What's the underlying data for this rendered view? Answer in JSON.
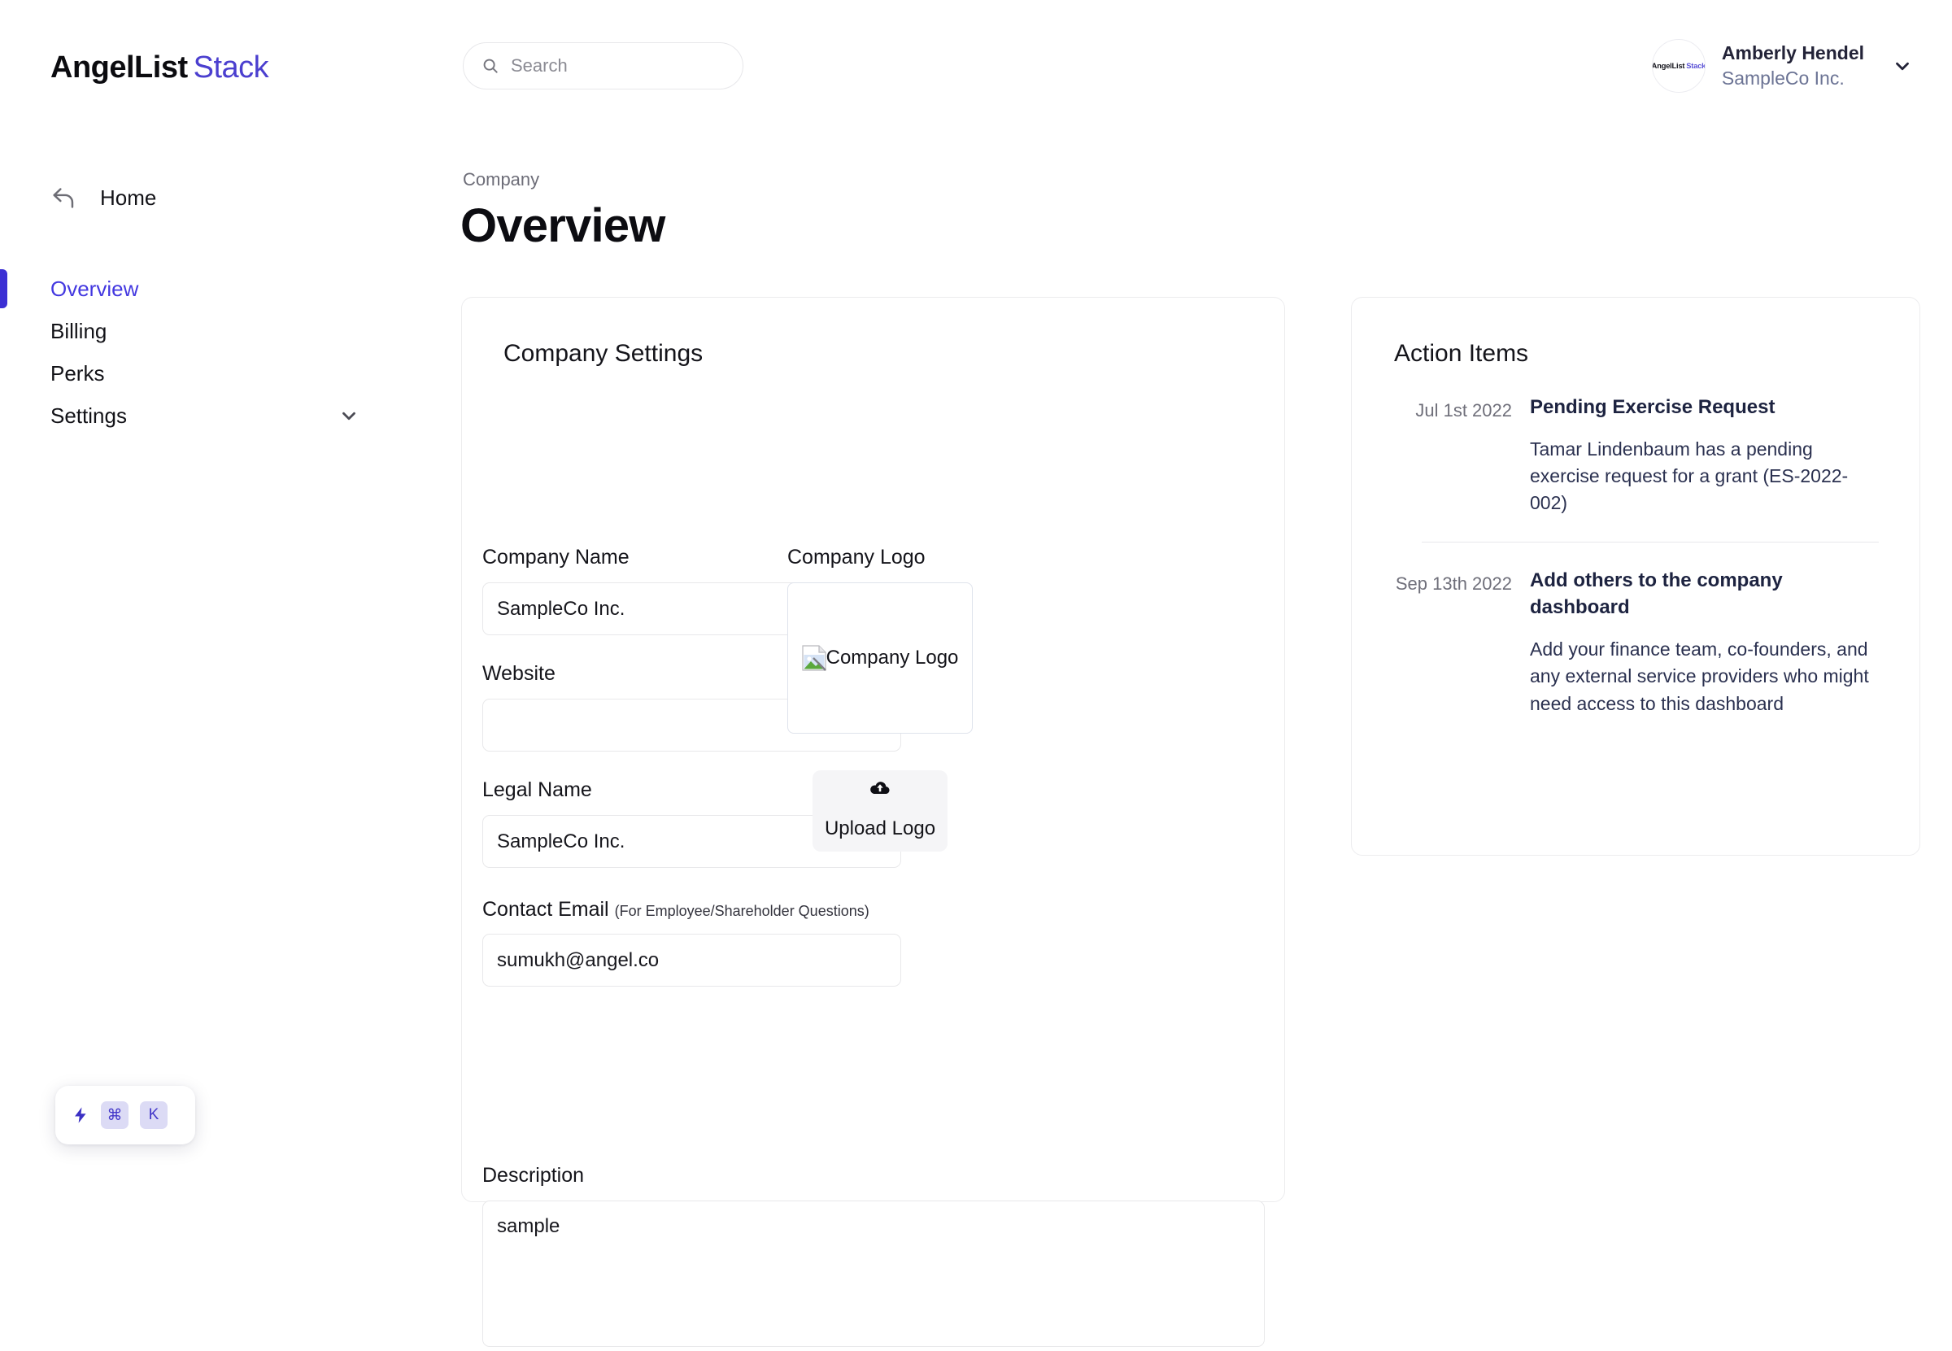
{
  "brand": {
    "primary": "AngelList",
    "secondary": "Stack",
    "accent_color": "#4b3fcf"
  },
  "search": {
    "placeholder": "Search",
    "value": "",
    "icon": "search-icon"
  },
  "user": {
    "name": "Amberly Hendel",
    "company": "SampleCo Inc.",
    "avatar_primary": "AngelList",
    "avatar_secondary": "Stack",
    "chevron_icon": "chevron-down-icon"
  },
  "sidebar": {
    "home": {
      "label": "Home",
      "icon": "back-arrow-icon"
    },
    "items": [
      {
        "label": "Overview",
        "active": true
      },
      {
        "label": "Billing",
        "active": false
      },
      {
        "label": "Perks",
        "active": false
      },
      {
        "label": "Settings",
        "active": false,
        "expandable": true,
        "icon": "chevron-down-icon"
      }
    ],
    "active_color": "#4338e0",
    "accent_bar_color": "#3b2fd4"
  },
  "command_widget": {
    "bolt_icon": "lightning-bolt-icon",
    "keys": [
      "⌘",
      "K"
    ],
    "key_color": "#4237c9",
    "key_bg": "#dcdbf5"
  },
  "page": {
    "breadcrumb": "Company",
    "title": "Overview"
  },
  "company_settings": {
    "heading": "Company Settings",
    "fields": {
      "company_name": {
        "label": "Company Name",
        "value": "SampleCo Inc.",
        "placeholder": ""
      },
      "website": {
        "label": "Website",
        "value": "",
        "placeholder": ""
      },
      "legal_name": {
        "label": "Legal Name",
        "value": "SampleCo Inc.",
        "placeholder": ""
      },
      "contact_email": {
        "label": "Contact Email",
        "hint": "(For Employee/Shareholder Questions)",
        "value": "sumukh@angel.co",
        "placeholder": ""
      },
      "description": {
        "label": "Description",
        "value": "sample",
        "placeholder": ""
      }
    },
    "logo": {
      "label": "Company Logo",
      "alt_text": "Company Logo",
      "broken_image_icon": "broken-image-icon",
      "upload_button": "Upload Logo",
      "upload_icon": "cloud-upload-icon"
    }
  },
  "action_items": {
    "heading": "Action Items",
    "items": [
      {
        "date": "Jul 1st 2022",
        "title": "Pending Exercise Request",
        "description": "Tamar Lindenbaum has a pending exercise request for a grant (ES-2022-002)"
      },
      {
        "date": "Sep 13th 2022",
        "title": "Add others to the company dashboard",
        "description": "Add your finance team, co-founders, and any external service providers who might need access to this dashboard"
      }
    ]
  }
}
